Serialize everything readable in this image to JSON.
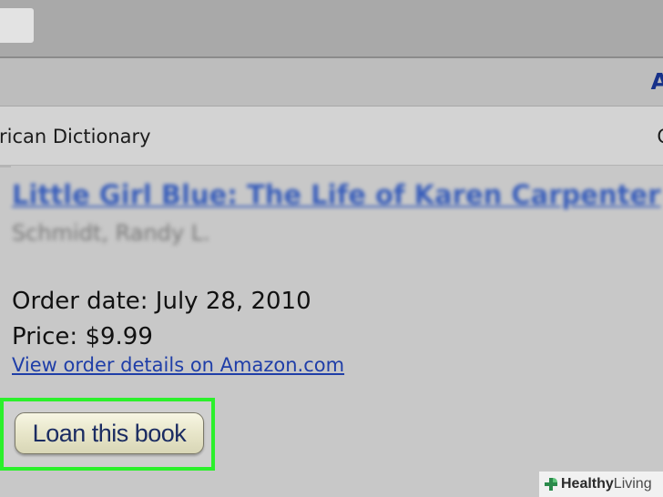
{
  "header": {
    "partial_letter": "A"
  },
  "dictionary_row": {
    "title": "rican Dictionary",
    "right_partial": "C"
  },
  "book": {
    "title": "Little Girl Blue: The Life of Karen Carpenter",
    "author": "Schmidt, Randy L.",
    "order_date": "Order date: July 28, 2010",
    "price": "Price: $9.99",
    "details_link": "View order details on Amazon.com"
  },
  "loan_button": {
    "label": "Loan this book",
    "highlight_color": "#2bf02b"
  },
  "watermark": {
    "brand_bold": "Healthy",
    "brand_light": "Living",
    "icon": "plus-leaf-icon",
    "color": "#2b8a4b"
  }
}
